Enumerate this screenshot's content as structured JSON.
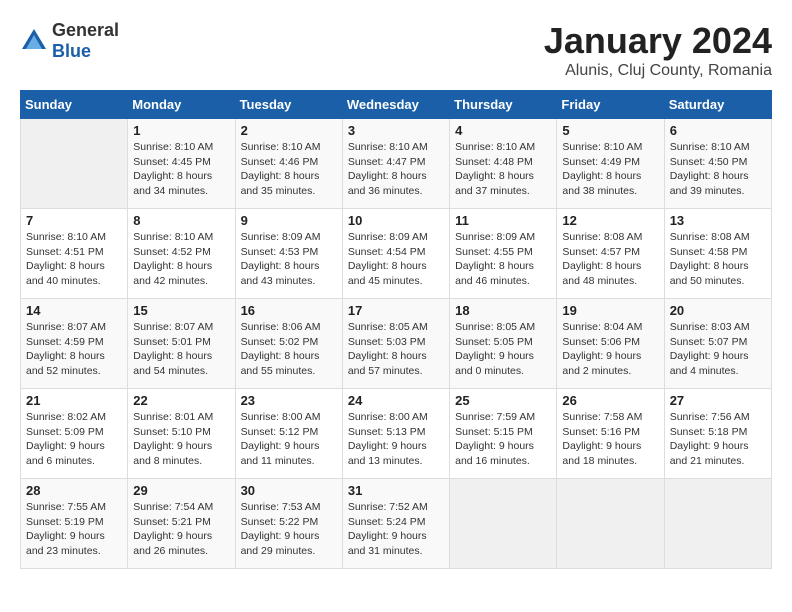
{
  "header": {
    "logo_general": "General",
    "logo_blue": "Blue",
    "month_title": "January 2024",
    "subtitle": "Alunis, Cluj County, Romania"
  },
  "weekdays": [
    "Sunday",
    "Monday",
    "Tuesday",
    "Wednesday",
    "Thursday",
    "Friday",
    "Saturday"
  ],
  "weeks": [
    [
      {
        "day": "",
        "sunrise": "",
        "sunset": "",
        "daylight": ""
      },
      {
        "day": "1",
        "sunrise": "Sunrise: 8:10 AM",
        "sunset": "Sunset: 4:45 PM",
        "daylight": "Daylight: 8 hours and 34 minutes."
      },
      {
        "day": "2",
        "sunrise": "Sunrise: 8:10 AM",
        "sunset": "Sunset: 4:46 PM",
        "daylight": "Daylight: 8 hours and 35 minutes."
      },
      {
        "day": "3",
        "sunrise": "Sunrise: 8:10 AM",
        "sunset": "Sunset: 4:47 PM",
        "daylight": "Daylight: 8 hours and 36 minutes."
      },
      {
        "day": "4",
        "sunrise": "Sunrise: 8:10 AM",
        "sunset": "Sunset: 4:48 PM",
        "daylight": "Daylight: 8 hours and 37 minutes."
      },
      {
        "day": "5",
        "sunrise": "Sunrise: 8:10 AM",
        "sunset": "Sunset: 4:49 PM",
        "daylight": "Daylight: 8 hours and 38 minutes."
      },
      {
        "day": "6",
        "sunrise": "Sunrise: 8:10 AM",
        "sunset": "Sunset: 4:50 PM",
        "daylight": "Daylight: 8 hours and 39 minutes."
      }
    ],
    [
      {
        "day": "7",
        "sunrise": "Sunrise: 8:10 AM",
        "sunset": "Sunset: 4:51 PM",
        "daylight": "Daylight: 8 hours and 40 minutes."
      },
      {
        "day": "8",
        "sunrise": "Sunrise: 8:10 AM",
        "sunset": "Sunset: 4:52 PM",
        "daylight": "Daylight: 8 hours and 42 minutes."
      },
      {
        "day": "9",
        "sunrise": "Sunrise: 8:09 AM",
        "sunset": "Sunset: 4:53 PM",
        "daylight": "Daylight: 8 hours and 43 minutes."
      },
      {
        "day": "10",
        "sunrise": "Sunrise: 8:09 AM",
        "sunset": "Sunset: 4:54 PM",
        "daylight": "Daylight: 8 hours and 45 minutes."
      },
      {
        "day": "11",
        "sunrise": "Sunrise: 8:09 AM",
        "sunset": "Sunset: 4:55 PM",
        "daylight": "Daylight: 8 hours and 46 minutes."
      },
      {
        "day": "12",
        "sunrise": "Sunrise: 8:08 AM",
        "sunset": "Sunset: 4:57 PM",
        "daylight": "Daylight: 8 hours and 48 minutes."
      },
      {
        "day": "13",
        "sunrise": "Sunrise: 8:08 AM",
        "sunset": "Sunset: 4:58 PM",
        "daylight": "Daylight: 8 hours and 50 minutes."
      }
    ],
    [
      {
        "day": "14",
        "sunrise": "Sunrise: 8:07 AM",
        "sunset": "Sunset: 4:59 PM",
        "daylight": "Daylight: 8 hours and 52 minutes."
      },
      {
        "day": "15",
        "sunrise": "Sunrise: 8:07 AM",
        "sunset": "Sunset: 5:01 PM",
        "daylight": "Daylight: 8 hours and 54 minutes."
      },
      {
        "day": "16",
        "sunrise": "Sunrise: 8:06 AM",
        "sunset": "Sunset: 5:02 PM",
        "daylight": "Daylight: 8 hours and 55 minutes."
      },
      {
        "day": "17",
        "sunrise": "Sunrise: 8:05 AM",
        "sunset": "Sunset: 5:03 PM",
        "daylight": "Daylight: 8 hours and 57 minutes."
      },
      {
        "day": "18",
        "sunrise": "Sunrise: 8:05 AM",
        "sunset": "Sunset: 5:05 PM",
        "daylight": "Daylight: 9 hours and 0 minutes."
      },
      {
        "day": "19",
        "sunrise": "Sunrise: 8:04 AM",
        "sunset": "Sunset: 5:06 PM",
        "daylight": "Daylight: 9 hours and 2 minutes."
      },
      {
        "day": "20",
        "sunrise": "Sunrise: 8:03 AM",
        "sunset": "Sunset: 5:07 PM",
        "daylight": "Daylight: 9 hours and 4 minutes."
      }
    ],
    [
      {
        "day": "21",
        "sunrise": "Sunrise: 8:02 AM",
        "sunset": "Sunset: 5:09 PM",
        "daylight": "Daylight: 9 hours and 6 minutes."
      },
      {
        "day": "22",
        "sunrise": "Sunrise: 8:01 AM",
        "sunset": "Sunset: 5:10 PM",
        "daylight": "Daylight: 9 hours and 8 minutes."
      },
      {
        "day": "23",
        "sunrise": "Sunrise: 8:00 AM",
        "sunset": "Sunset: 5:12 PM",
        "daylight": "Daylight: 9 hours and 11 minutes."
      },
      {
        "day": "24",
        "sunrise": "Sunrise: 8:00 AM",
        "sunset": "Sunset: 5:13 PM",
        "daylight": "Daylight: 9 hours and 13 minutes."
      },
      {
        "day": "25",
        "sunrise": "Sunrise: 7:59 AM",
        "sunset": "Sunset: 5:15 PM",
        "daylight": "Daylight: 9 hours and 16 minutes."
      },
      {
        "day": "26",
        "sunrise": "Sunrise: 7:58 AM",
        "sunset": "Sunset: 5:16 PM",
        "daylight": "Daylight: 9 hours and 18 minutes."
      },
      {
        "day": "27",
        "sunrise": "Sunrise: 7:56 AM",
        "sunset": "Sunset: 5:18 PM",
        "daylight": "Daylight: 9 hours and 21 minutes."
      }
    ],
    [
      {
        "day": "28",
        "sunrise": "Sunrise: 7:55 AM",
        "sunset": "Sunset: 5:19 PM",
        "daylight": "Daylight: 9 hours and 23 minutes."
      },
      {
        "day": "29",
        "sunrise": "Sunrise: 7:54 AM",
        "sunset": "Sunset: 5:21 PM",
        "daylight": "Daylight: 9 hours and 26 minutes."
      },
      {
        "day": "30",
        "sunrise": "Sunrise: 7:53 AM",
        "sunset": "Sunset: 5:22 PM",
        "daylight": "Daylight: 9 hours and 29 minutes."
      },
      {
        "day": "31",
        "sunrise": "Sunrise: 7:52 AM",
        "sunset": "Sunset: 5:24 PM",
        "daylight": "Daylight: 9 hours and 31 minutes."
      },
      {
        "day": "",
        "sunrise": "",
        "sunset": "",
        "daylight": ""
      },
      {
        "day": "",
        "sunrise": "",
        "sunset": "",
        "daylight": ""
      },
      {
        "day": "",
        "sunrise": "",
        "sunset": "",
        "daylight": ""
      }
    ]
  ]
}
